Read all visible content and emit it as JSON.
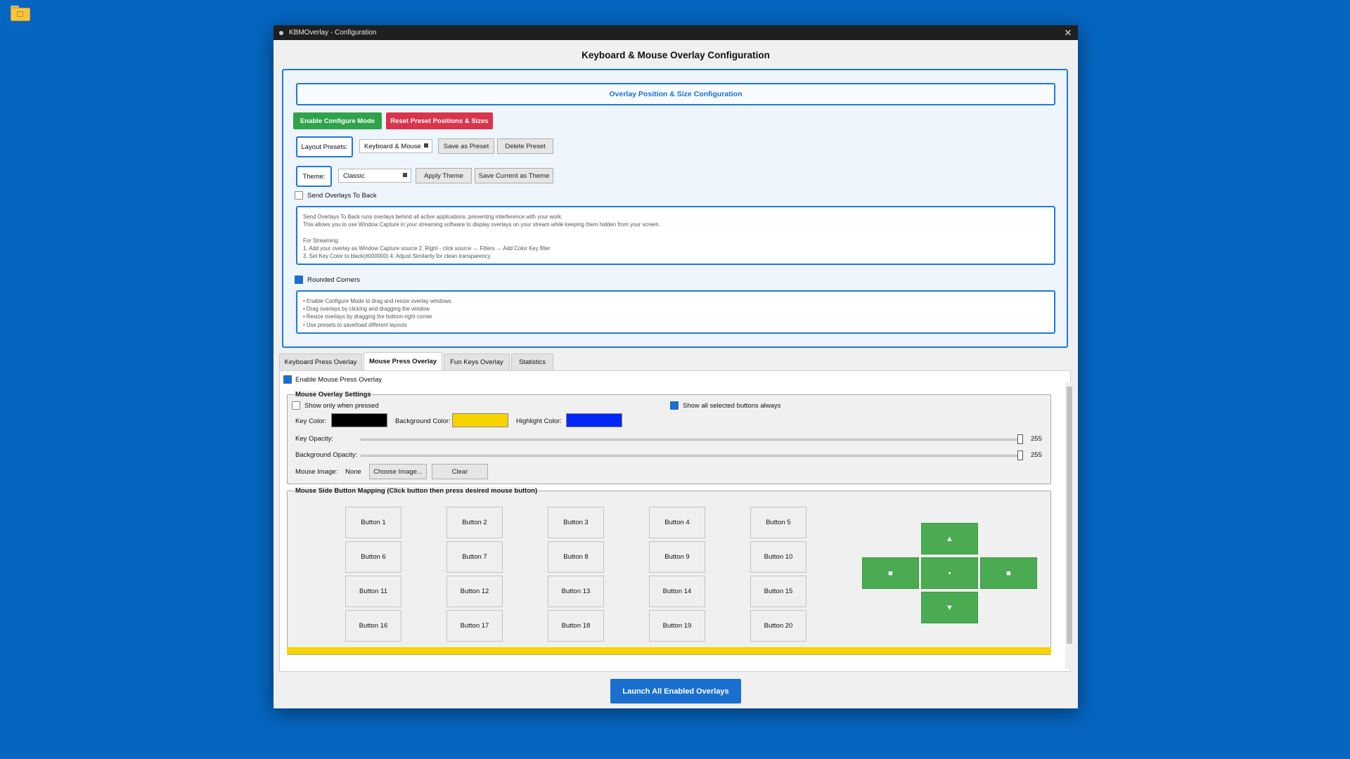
{
  "window": {
    "title": "KBMOverlay - Configuration",
    "close_glyph": "✕"
  },
  "main_title": "Keyboard & Mouse Overlay Configuration",
  "config": {
    "section_title": "Overlay Position & Size Configuration",
    "enable_configure_mode": "Enable Configure Mode",
    "reset_preset": "Reset Preset Positions & Sizes",
    "layout_presets_label": "Layout Presets:",
    "layout_presets_value": "Keyboard & Mouse",
    "save_as_preset": "Save as Preset",
    "delete_preset": "Delete Preset",
    "theme_label": "Theme:",
    "theme_value": "Classic",
    "apply_theme": "Apply Theme",
    "save_current_theme": "Save Current as Theme",
    "send_to_back_label": "Send Overlays To Back",
    "send_to_back_checked": false,
    "send_to_back_info": [
      "Send Overlays To Back runs overlays behind all active applications, preventing interference with your work.",
      "This allows you to use Window Capture in your streaming software to display overlays on your stream while keeping them hidden from your screen.",
      "",
      "For Streaming:",
      "1. Add your overlay as Window Capture source 2. Right - click source → Filters → Add Color Key filter",
      "3. Set Key Color to black(#000000) 4. Adjust Similarity for clean transparency"
    ],
    "rounded_corners_label": "Rounded Corners",
    "rounded_corners_checked": true,
    "tips": [
      "• Enable Configure Mode to drag and resize overlay windows",
      "• Drag overlays by clicking and dragging the window",
      "• Resize overlays by dragging the bottom-right corner",
      "• Use presets to save/load different layouts"
    ]
  },
  "tabs": [
    {
      "label": "Keyboard Press Overlay",
      "active": false
    },
    {
      "label": "Mouse Press Overlay",
      "active": true
    },
    {
      "label": "Fun Keys Overlay",
      "active": false
    },
    {
      "label": "Statistics",
      "active": false
    }
  ],
  "mouse_tab": {
    "enable_label": "Enable Mouse Press Overlay",
    "enable_checked": true,
    "settings_title": "Mouse Overlay Settings",
    "show_only_pressed": "Show only when pressed",
    "show_only_pressed_checked": false,
    "show_all_selected": "Show all selected buttons always",
    "show_all_selected_checked": true,
    "key_color_label": "Key Color:",
    "key_color": "#000000",
    "bg_color_label": "Background Color:",
    "bg_color": "#f7d300",
    "highlight_color_label": "Highlight Color:",
    "highlight_color": "#0027f5",
    "key_opacity_label": "Key Opacity:",
    "key_opacity_value": "255",
    "bg_opacity_label": "Background Opacity:",
    "bg_opacity_value": "255",
    "mouse_image_label": "Mouse Image:",
    "mouse_image_value": "None",
    "choose_image": "Choose Image...",
    "clear": "Clear",
    "mapping_title": "Mouse Side Button Mapping (Click button then press desired mouse button)",
    "buttons": [
      "Button 1",
      "Button 2",
      "Button 3",
      "Button 4",
      "Button 5",
      "Button 6",
      "Button 7",
      "Button 8",
      "Button 9",
      "Button 10",
      "Button 11",
      "Button 12",
      "Button 13",
      "Button 14",
      "Button 15",
      "Button 16",
      "Button 17",
      "Button 18",
      "Button 19",
      "Button 20"
    ],
    "dpad": {
      "up": "▲",
      "left": "■",
      "center": "•",
      "right": "■",
      "down": "▼",
      "color": "#4bab52"
    }
  },
  "launch_button": "Launch All Enabled Overlays"
}
